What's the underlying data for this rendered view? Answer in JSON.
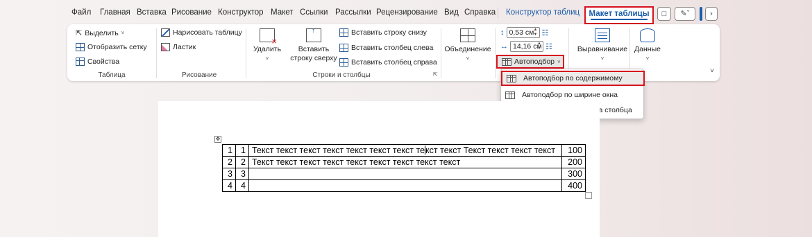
{
  "tabs": [
    {
      "label": "Файл"
    },
    {
      "label": "Главная"
    },
    {
      "label": "Вставка"
    },
    {
      "label": "Рисование"
    },
    {
      "label": "Конструктор"
    },
    {
      "label": "Макет"
    },
    {
      "label": "Ссылки"
    },
    {
      "label": "Рассылки"
    },
    {
      "label": "Рецензирование"
    },
    {
      "label": "Вид"
    },
    {
      "label": "Справка"
    }
  ],
  "context_tab": "Конструктор таблиц",
  "active_tab": "Макет таблицы",
  "ribbon": {
    "table_group": {
      "select": "Выделить",
      "gridlines": "Отобразить сетку",
      "properties": "Свойства",
      "label": "Таблица"
    },
    "draw_group": {
      "draw_table": "Нарисовать таблицу",
      "eraser": "Ластик",
      "label": "Рисование"
    },
    "rows_cols_group": {
      "delete": "Удалить",
      "insert_above_line1": "Вставить",
      "insert_above_line2": "строку сверху",
      "insert_below": "Вставить строку снизу",
      "insert_left": "Вставить столбец слева",
      "insert_right": "Вставить столбец справа",
      "label": "Строки и столбцы"
    },
    "merge": "Объединение",
    "cell_size": {
      "height": "0,53 см",
      "width": "14,16 см",
      "autofit": "Автоподбор"
    },
    "alignment": "Выравнивание",
    "data": "Данные"
  },
  "autofit_menu": {
    "items": [
      {
        "label": "Автоподбор по содержимому",
        "selected": true
      },
      {
        "label": "Автоподбор по ширине окна",
        "selected": false
      },
      {
        "label": "Фиксированная ширина столбца",
        "selected": false
      }
    ]
  },
  "document_table": {
    "rows": [
      {
        "a": "1",
        "b": "1",
        "text_before": "Текст текст текст текст текст текст текст те",
        "text_after": "кст текст Текст текст текст текст",
        "value": "100"
      },
      {
        "a": "2",
        "b": "2",
        "text_before": "Текст текст текст текст текст текст текст текст текст",
        "text_after": "",
        "value": "200"
      },
      {
        "a": "3",
        "b": "3",
        "text_before": "",
        "text_after": "",
        "value": "300"
      },
      {
        "a": "4",
        "b": "4",
        "text_before": "",
        "text_after": "",
        "value": "400"
      }
    ]
  }
}
